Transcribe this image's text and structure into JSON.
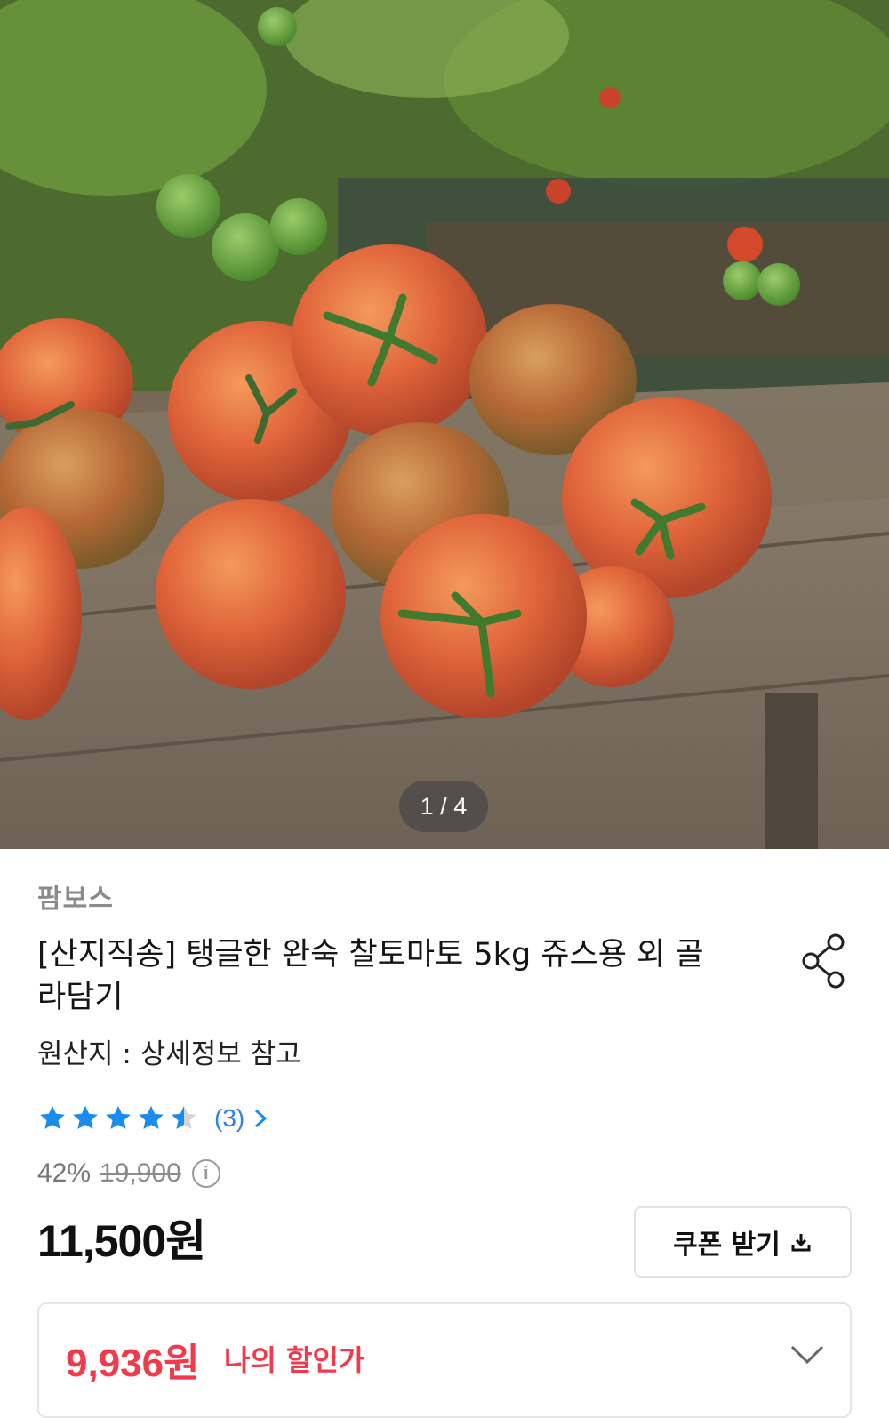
{
  "gallery": {
    "counter": "1 / 4"
  },
  "product": {
    "seller": "팜보스",
    "title": "[산지직송] 탱글한 완숙 찰토마토 5kg 쥬스용 외 골라담기",
    "origin": "원산지 : 상세정보 참고"
  },
  "rating": {
    "stars": 4.5,
    "max_stars": 5,
    "review_count": "(3)",
    "star_color": "#1a8cf0"
  },
  "pricing": {
    "discount_percent": "42%",
    "original_price": "19,900",
    "price_number": "11,500",
    "price_unit": "원",
    "coupon_button": "쿠폰 받기",
    "my_price_amount": "9,936원",
    "my_price_label": "나의 할인가",
    "accent_color": "#ef3b4c"
  },
  "icons": {
    "share": "share-icon",
    "info": "info-icon",
    "download": "download-icon",
    "chevron_right": "chevron-right-icon",
    "chevron_down": "chevron-down-icon"
  }
}
